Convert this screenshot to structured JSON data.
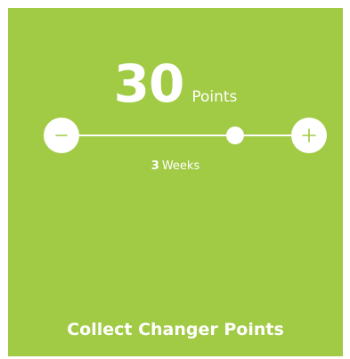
{
  "colors": {
    "background": "#a1ca45",
    "foreground": "#ffffff",
    "icon": "#a1ca45"
  },
  "points": {
    "value": "30",
    "unit": "Points"
  },
  "slider": {
    "level_fraction": 0.7,
    "decrease_icon": "minus-icon",
    "increase_icon": "plus-icon"
  },
  "duration": {
    "value": "3",
    "unit": "Weeks"
  },
  "footer": {
    "title": "Collect Changer Points"
  }
}
